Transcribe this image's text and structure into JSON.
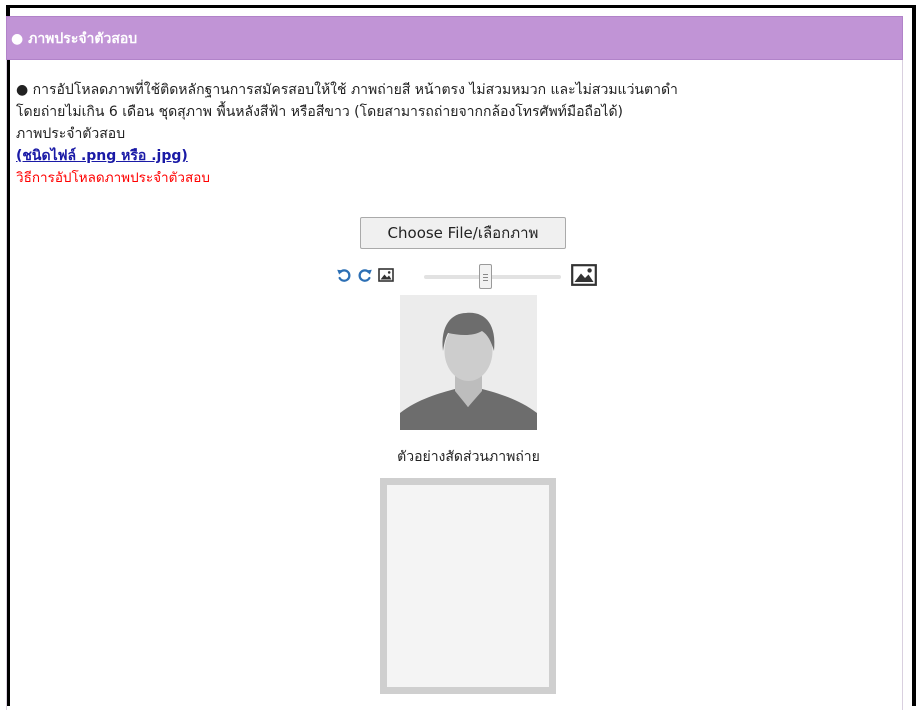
{
  "panel": {
    "title": "● ภาพประจำตัวสอบ"
  },
  "instructions": {
    "line1": "● การอัปโหลดภาพที่ใช้ติดหลักฐานการสมัครสอบให้ใช้ ภาพถ่ายสี หน้าตรง ไม่สวมหมวก และไม่สวมแว่นตาดำ",
    "line2": "โดยถ่ายไม่เกิน 6 เดือน ชุดสุภาพ พื้นหลังสีฟ้า หรือสีขาว (โดยสามารถถ่ายจากกล้องโทรศัพท์มือถือได้)",
    "line3": "ภาพประจำตัวสอบ",
    "file_types": "(ชนิดไฟล์ .png หรือ .jpg)",
    "upload_howto": "วิธีการอัปโหลดภาพประจำตัวสอบ"
  },
  "upload": {
    "choose_label": "Choose File/เลือกภาพ"
  },
  "editor": {
    "zoom_level": 0.45,
    "icons": [
      "rotate-left-icon",
      "rotate-right-icon",
      "image-small-icon",
      "image-large-icon"
    ],
    "icon_color": "#2c6fb4"
  },
  "example": {
    "caption": "ตัวอย่างสัดส่วนภาพถ่าย"
  },
  "colors": {
    "header_bg": "#c194d6",
    "link": "#1a1aa6",
    "warning": "#ff0000"
  }
}
